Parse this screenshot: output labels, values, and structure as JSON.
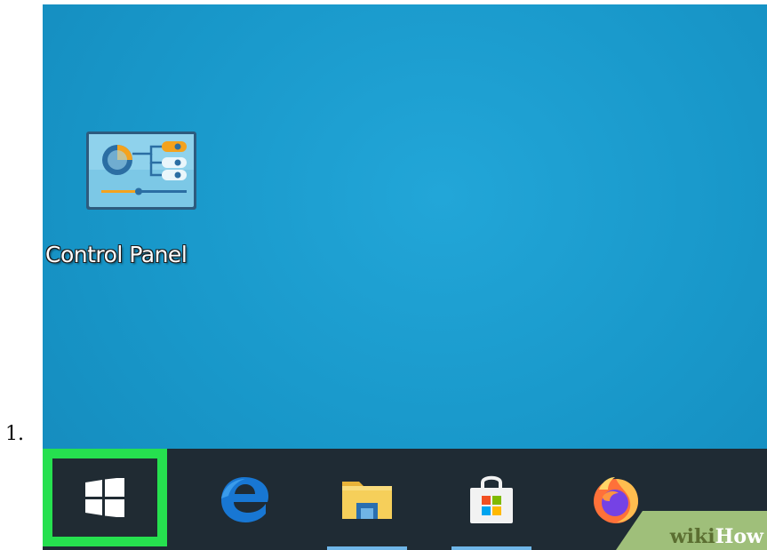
{
  "list_marker": "1.",
  "desktop": {
    "icons": [
      {
        "label": "Control Panel",
        "icon": "control-panel-icon"
      }
    ]
  },
  "taskbar": {
    "highlight_color": "#26e04f",
    "buttons": [
      {
        "name": "start",
        "icon": "windows-logo-icon"
      },
      {
        "name": "edge",
        "icon": "edge-icon"
      },
      {
        "name": "file-explorer",
        "icon": "folder-icon"
      },
      {
        "name": "store",
        "icon": "store-bag-icon"
      },
      {
        "name": "firefox",
        "icon": "firefox-icon"
      }
    ]
  },
  "watermark": {
    "part1": "wiki",
    "part2": "How"
  }
}
